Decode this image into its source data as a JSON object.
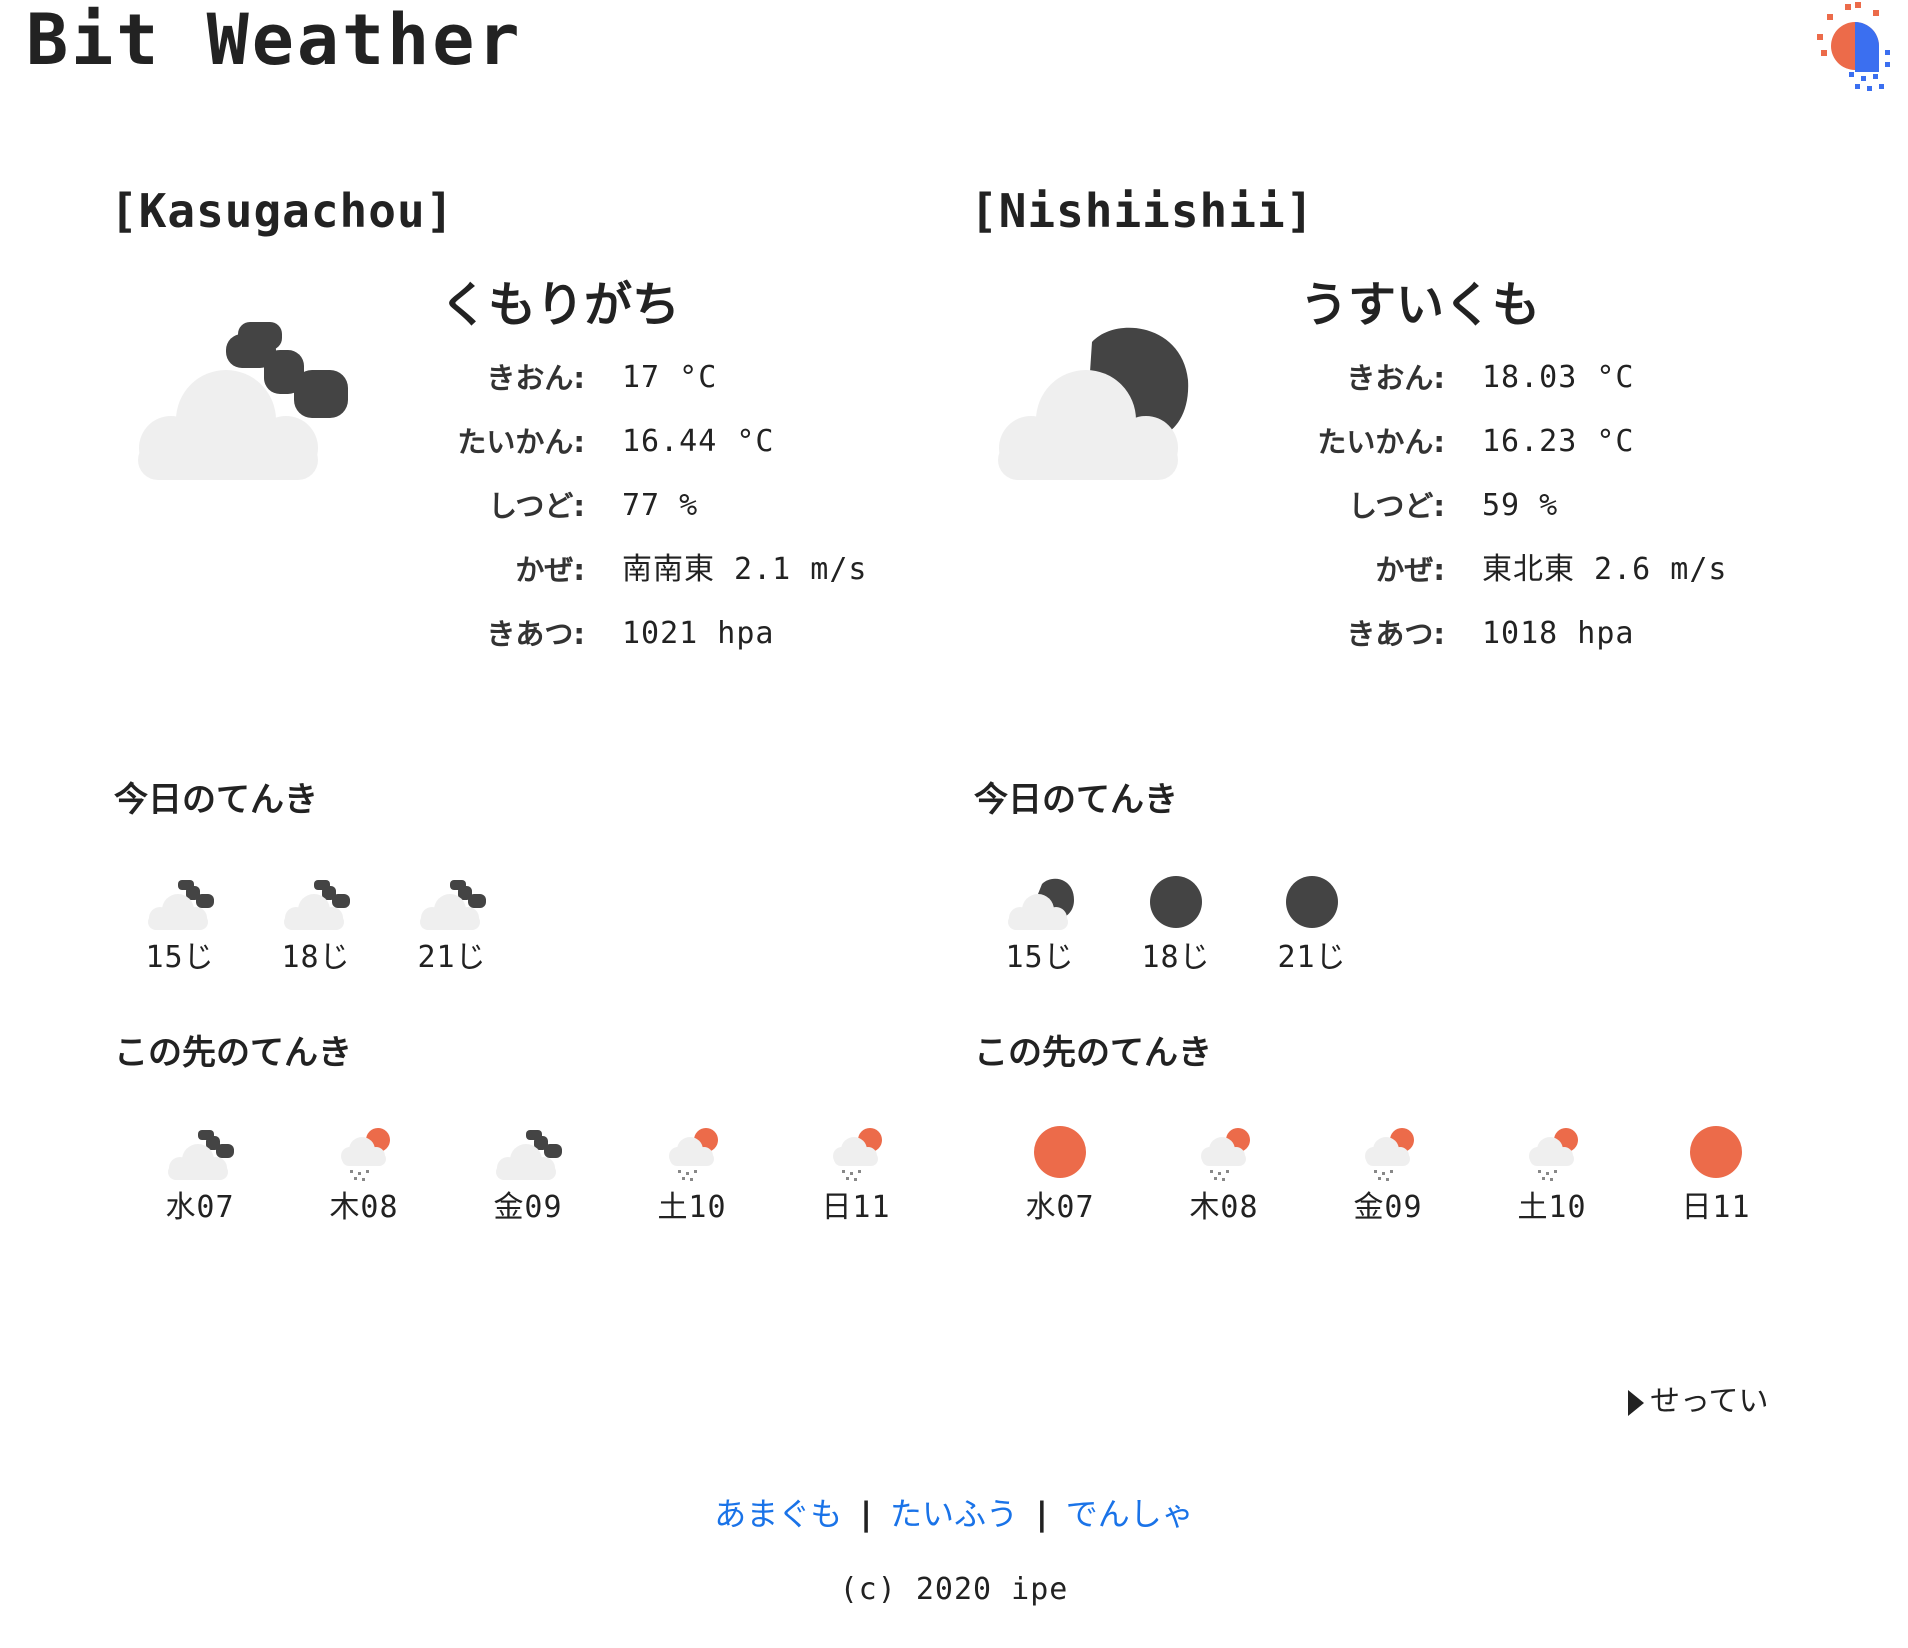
{
  "header": {
    "title": "Bit Weather",
    "logo_icon": "sun-rain-logo-icon"
  },
  "colors": {
    "sun": "#ec6b4a",
    "rain_blue": "#3b6ff0",
    "cloud": "#efefef",
    "cloud_dark": "#444444",
    "link": "#1a73e8",
    "text": "#222222"
  },
  "locations": [
    {
      "name": "[Kasugachou]",
      "condition": "くもりがち",
      "icon": "broken-clouds-icon",
      "stats": [
        {
          "label": "きおん:",
          "value": "17 °C"
        },
        {
          "label": "たいかん:",
          "value": "16.44 °C"
        },
        {
          "label": "しつど:",
          "value": "77 %"
        },
        {
          "label": "かぜ:",
          "value": "南南東 2.1 m/s"
        },
        {
          "label": "きあつ:",
          "value": "1021 hpa"
        }
      ],
      "today_title": "今日のてんき",
      "today": [
        {
          "time": "15じ",
          "icon": "broken-clouds-icon"
        },
        {
          "time": "18じ",
          "icon": "broken-clouds-icon"
        },
        {
          "time": "21じ",
          "icon": "broken-clouds-icon"
        }
      ],
      "future_title": "この先のてんき",
      "future": [
        {
          "day": "水07",
          "icon": "broken-clouds-icon"
        },
        {
          "day": "木08",
          "icon": "light-rain-icon"
        },
        {
          "day": "金09",
          "icon": "broken-clouds-icon"
        },
        {
          "day": "土10",
          "icon": "light-rain-icon"
        },
        {
          "day": "日11",
          "icon": "light-rain-icon"
        }
      ]
    },
    {
      "name": "[Nishiishii]",
      "condition": "うすいくも",
      "icon": "scattered-clouds-icon",
      "stats": [
        {
          "label": "きおん:",
          "value": "18.03 °C"
        },
        {
          "label": "たいかん:",
          "value": "16.23 °C"
        },
        {
          "label": "しつど:",
          "value": "59 %"
        },
        {
          "label": "かぜ:",
          "value": "東北東 2.6 m/s"
        },
        {
          "label": "きあつ:",
          "value": "1018 hpa"
        }
      ],
      "today_title": "今日のてんき",
      "today": [
        {
          "time": "15じ",
          "icon": "scattered-clouds-icon"
        },
        {
          "time": "18じ",
          "icon": "clear-night-icon"
        },
        {
          "time": "21じ",
          "icon": "clear-night-icon"
        }
      ],
      "future_title": "この先のてんき",
      "future": [
        {
          "day": "水07",
          "icon": "clear-sky-icon"
        },
        {
          "day": "木08",
          "icon": "light-rain-icon"
        },
        {
          "day": "金09",
          "icon": "light-rain-icon"
        },
        {
          "day": "土10",
          "icon": "light-rain-icon"
        },
        {
          "day": "日11",
          "icon": "clear-sky-icon"
        }
      ]
    }
  ],
  "settings": {
    "label": "せってい"
  },
  "footer": {
    "links": [
      "あまぐも",
      "たいふう",
      "でんしゃ"
    ],
    "separator": "|",
    "copyright": "(c) 2020 ipe"
  }
}
